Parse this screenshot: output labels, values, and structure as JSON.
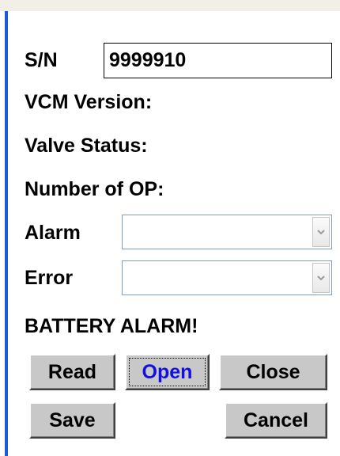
{
  "form": {
    "sn_label": "S/N",
    "sn_value": "9999910",
    "vcm_version_label": "VCM Version:",
    "valve_status_label": "Valve Status:",
    "number_of_op_label": "Number of OP:",
    "alarm_label": "Alarm",
    "alarm_value": "",
    "error_label": "Error",
    "error_value": "",
    "battery_alarm": "BATTERY ALARM!"
  },
  "buttons": {
    "read": "Read",
    "open": "Open",
    "close": "Close",
    "save": "Save",
    "cancel": "Cancel"
  },
  "colors": {
    "accent_bar": "#1f5ad6",
    "focused_button_text": "#1010e0",
    "button_face": "#c8c8c8"
  }
}
